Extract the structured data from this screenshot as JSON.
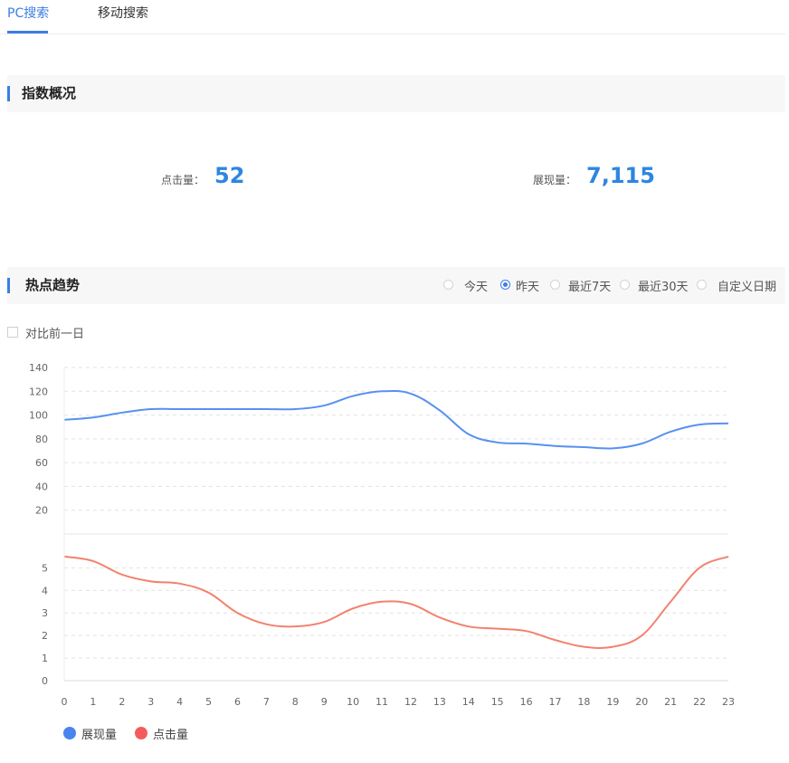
{
  "tabs": [
    {
      "label": "PC搜索",
      "active": true
    },
    {
      "label": "移动搜索",
      "active": false
    }
  ],
  "overview": {
    "title": "指数概况",
    "metrics": [
      {
        "label": "点击量：",
        "value": "52"
      },
      {
        "label": "展现量：",
        "value": "7,115"
      }
    ]
  },
  "trend": {
    "title": "热点趋势",
    "ranges": [
      {
        "label": "今天",
        "checked": false
      },
      {
        "label": "昨天",
        "checked": true
      },
      {
        "label": "最近7天",
        "checked": false
      },
      {
        "label": "最近30天",
        "checked": false
      },
      {
        "label": "自定义日期",
        "checked": false
      }
    ],
    "compare_label": "对比前一日"
  },
  "colors": {
    "accent": "#3b7de6",
    "impressions_line": "#5791f0",
    "clicks_line": "#f2826e",
    "impressions_legend": "#4a84ee",
    "clicks_legend": "#f45c5c",
    "metric_value": "#2e86e0"
  },
  "chart_data": [
    {
      "type": "line",
      "x": [
        0,
        1,
        2,
        3,
        4,
        5,
        6,
        7,
        8,
        9,
        10,
        11,
        12,
        13,
        14,
        15,
        16,
        17,
        18,
        19,
        20,
        21,
        22,
        23
      ],
      "series": [
        {
          "name": "展现量",
          "values": [
            96,
            98,
            102,
            105,
            105,
            105,
            105,
            105,
            105,
            108,
            116,
            120,
            118,
            104,
            84,
            77,
            76,
            74,
            73,
            72,
            76,
            86,
            92,
            93
          ]
        }
      ],
      "ylim": [
        0,
        140
      ],
      "yticks": [
        20,
        40,
        60,
        80,
        100,
        120,
        140
      ],
      "grid": true
    },
    {
      "type": "line",
      "x": [
        0,
        1,
        2,
        3,
        4,
        5,
        6,
        7,
        8,
        9,
        10,
        11,
        12,
        13,
        14,
        15,
        16,
        17,
        18,
        19,
        20,
        21,
        22,
        23
      ],
      "xticks": [
        "0",
        "1",
        "2",
        "3",
        "4",
        "5",
        "6",
        "7",
        "8",
        "9",
        "10",
        "11",
        "12",
        "13",
        "14",
        "15",
        "16",
        "17",
        "18",
        "19",
        "20",
        "21",
        "22",
        "23"
      ],
      "series": [
        {
          "name": "点击量",
          "values": [
            5.5,
            5.3,
            4.7,
            4.4,
            4.3,
            3.9,
            3.0,
            2.5,
            2.4,
            2.6,
            3.2,
            3.5,
            3.4,
            2.8,
            2.4,
            2.3,
            2.2,
            1.8,
            1.5,
            1.5,
            2.0,
            3.5,
            5.0,
            5.5
          ]
        }
      ],
      "ylim": [
        0,
        6.5
      ],
      "yticks": [
        0,
        1,
        2,
        3,
        4,
        5
      ],
      "grid": true
    }
  ],
  "legend": [
    {
      "name": "展现量"
    },
    {
      "name": "点击量"
    }
  ]
}
